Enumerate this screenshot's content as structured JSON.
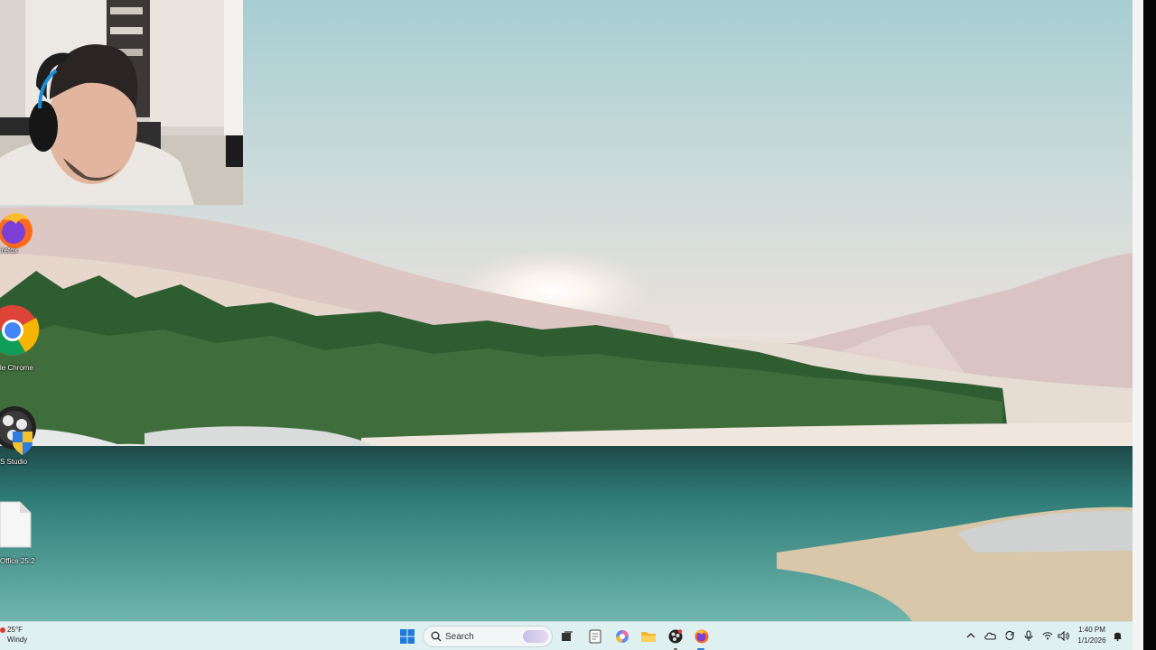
{
  "desktop": {
    "icons": [
      {
        "name": "firefox",
        "label": "irefox"
      },
      {
        "name": "chrome",
        "label": "le Chrome"
      },
      {
        "name": "obs",
        "label": "S Studio"
      },
      {
        "name": "office",
        "label": "Office 25.2"
      }
    ]
  },
  "taskbar": {
    "weather": {
      "temp": "25°F",
      "condition": "Windy"
    },
    "search_label": "Search",
    "clock": {
      "time": "1:40 PM",
      "date": "1/1/2026"
    }
  },
  "colors": {
    "taskbar_bg": "#dff0f1",
    "accent": "#3a7bd5",
    "windows_blue": "#1f7ad8"
  }
}
